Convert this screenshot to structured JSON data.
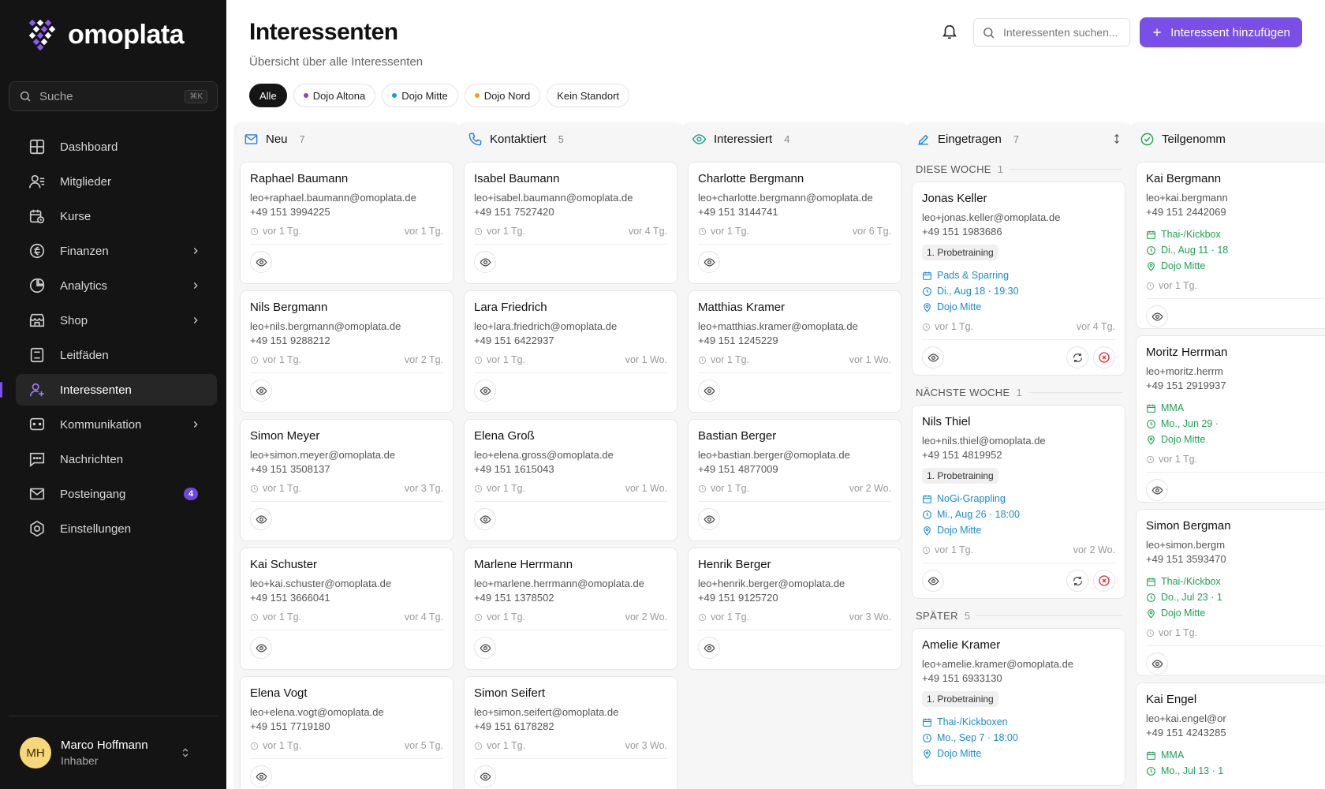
{
  "brand": {
    "name": "omoplata"
  },
  "sidebar": {
    "search_label": "Suche",
    "search_shortcut": "⌘K",
    "items": [
      {
        "label": "Dashboard",
        "icon": "dashboard-icon"
      },
      {
        "label": "Mitglieder",
        "icon": "members-icon"
      },
      {
        "label": "Kurse",
        "icon": "calendar-clock-icon"
      },
      {
        "label": "Finanzen",
        "icon": "finance-icon",
        "has_submenu": true
      },
      {
        "label": "Analytics",
        "icon": "pie-chart-icon",
        "has_submenu": true
      },
      {
        "label": "Shop",
        "icon": "store-icon",
        "has_submenu": true
      },
      {
        "label": "Leitfäden",
        "icon": "guide-icon"
      },
      {
        "label": "Interessenten",
        "icon": "user-plus-icon",
        "active": true
      },
      {
        "label": "Kommunikation",
        "icon": "communication-icon",
        "has_submenu": true
      },
      {
        "label": "Nachrichten",
        "icon": "message-icon"
      },
      {
        "label": "Posteingang",
        "icon": "mail-icon",
        "badge": "4"
      },
      {
        "label": "Einstellungen",
        "icon": "settings-icon"
      }
    ],
    "user": {
      "initials": "MH",
      "name": "Marco Hoffmann",
      "role": "Inhaber"
    }
  },
  "header": {
    "title": "Interessenten",
    "subtitle": "Übersicht über alle Interessenten",
    "search_placeholder": "Interessenten suchen...",
    "add_button": "Interessent hinzufügen"
  },
  "filters": [
    {
      "label": "Alle",
      "active": true
    },
    {
      "label": "Dojo Altona",
      "dot": "#8b3fd6"
    },
    {
      "label": "Dojo Mitte",
      "dot": "#1a9bd6"
    },
    {
      "label": "Dojo Nord",
      "dot": "#f0a020"
    },
    {
      "label": "Kein Standort"
    }
  ],
  "columns": {
    "neu": {
      "title": "Neu",
      "count": "7",
      "cards": [
        {
          "name": "Raphael Baumann",
          "email": "leo+raphael.baumann@omoplata.de",
          "phone": "+49 151 3994225",
          "created": "vor 1 Tg.",
          "updated": "vor 1 Tg."
        },
        {
          "name": "Nils Bergmann",
          "email": "leo+nils.bergmann@omoplata.de",
          "phone": "+49 151 9288212",
          "created": "vor 1 Tg.",
          "updated": "vor 2 Tg."
        },
        {
          "name": "Simon Meyer",
          "email": "leo+simon.meyer@omoplata.de",
          "phone": "+49 151 3508137",
          "created": "vor 1 Tg.",
          "updated": "vor 3 Tg."
        },
        {
          "name": "Kai Schuster",
          "email": "leo+kai.schuster@omoplata.de",
          "phone": "+49 151 3666041",
          "created": "vor 1 Tg.",
          "updated": "vor 4 Tg."
        },
        {
          "name": "Elena Vogt",
          "email": "leo+elena.vogt@omoplata.de",
          "phone": "+49 151 7719180",
          "created": "vor 1 Tg.",
          "updated": "vor 5 Tg."
        }
      ]
    },
    "kontaktiert": {
      "title": "Kontaktiert",
      "count": "5",
      "cards": [
        {
          "name": "Isabel Baumann",
          "email": "leo+isabel.baumann@omoplata.de",
          "phone": "+49 151 7527420",
          "created": "vor 1 Tg.",
          "updated": "vor 4 Tg."
        },
        {
          "name": "Lara Friedrich",
          "email": "leo+lara.friedrich@omoplata.de",
          "phone": "+49 151 6422937",
          "created": "vor 1 Tg.",
          "updated": "vor 1 Wo."
        },
        {
          "name": "Elena Groß",
          "email": "leo+elena.gross@omoplata.de",
          "phone": "+49 151 1615043",
          "created": "vor 1 Tg.",
          "updated": "vor 1 Wo."
        },
        {
          "name": "Marlene Herrmann",
          "email": "leo+marlene.herrmann@omoplata.de",
          "phone": "+49 151 1378502",
          "created": "vor 1 Tg.",
          "updated": "vor 2 Wo."
        },
        {
          "name": "Simon Seifert",
          "email": "leo+simon.seifert@omoplata.de",
          "phone": "+49 151 6178282",
          "created": "vor 1 Tg.",
          "updated": "vor 3 Wo."
        }
      ]
    },
    "interessiert": {
      "title": "Interessiert",
      "count": "4",
      "cards": [
        {
          "name": "Charlotte Bergmann",
          "email": "leo+charlotte.bergmann@omoplata.de",
          "phone": "+49 151 3144741",
          "created": "vor 1 Tg.",
          "updated": "vor 6 Tg."
        },
        {
          "name": "Matthias Kramer",
          "email": "leo+matthias.kramer@omoplata.de",
          "phone": "+49 151 1245229",
          "created": "vor 1 Tg.",
          "updated": "vor 1 Wo."
        },
        {
          "name": "Bastian Berger",
          "email": "leo+bastian.berger@omoplata.de",
          "phone": "+49 151 4877009",
          "created": "vor 1 Tg.",
          "updated": "vor 2 Wo."
        },
        {
          "name": "Henrik Berger",
          "email": "leo+henrik.berger@omoplata.de",
          "phone": "+49 151 9125720",
          "created": "vor 1 Tg.",
          "updated": "vor 3 Wo."
        }
      ]
    },
    "eingetragen": {
      "title": "Eingetragen",
      "count": "7",
      "sections": [
        {
          "label": "DIESE WOCHE",
          "count": "1",
          "card": {
            "name": "Jonas Keller",
            "email": "leo+jonas.keller@omoplata.de",
            "phone": "+49 151 1983686",
            "badge": "1. Probetraining",
            "course": "Pads & Sparring",
            "date": "Di., Aug 18 · 19:30",
            "location": "Dojo Mitte",
            "created": "vor 1 Tg.",
            "updated": "vor 4 Tg."
          }
        },
        {
          "label": "NÄCHSTE WOCHE",
          "count": "1",
          "card": {
            "name": "Nils Thiel",
            "email": "leo+nils.thiel@omoplata.de",
            "phone": "+49 151 4819952",
            "badge": "1. Probetraining",
            "course": "NoGi-Grappling",
            "date": "Mi., Aug 26 · 18:00",
            "location": "Dojo Mitte",
            "created": "vor 1 Tg.",
            "updated": "vor 2 Wo."
          }
        },
        {
          "label": "SPÄTER",
          "count": "5",
          "card": {
            "name": "Amelie Kramer",
            "email": "leo+amelie.kramer@omoplata.de",
            "phone": "+49 151 6933130",
            "badge": "1. Probetraining",
            "course": "Thai-/Kickboxen",
            "date": "Mo., Sep 7 · 18:00",
            "location": "Dojo Mitte"
          }
        }
      ]
    },
    "teilgenommen": {
      "title": "Teilgenomm",
      "cards": [
        {
          "name": "Kai Bergmann",
          "email": "leo+kai.bergmann",
          "phone": "+49 151 2442069",
          "course": "Thai-/Kickbox",
          "date": "Di., Aug 11 · 18",
          "location": "Dojo Mitte",
          "created": "vor 1 Tg."
        },
        {
          "name": "Moritz Herrman",
          "email": "leo+moritz.herrm",
          "phone": "+49 151 2919937",
          "course": "MMA",
          "date": "Mo., Jun 29 ·",
          "location": "Dojo Mitte",
          "created": "vor 1 Tg."
        },
        {
          "name": "Simon Bergman",
          "email": "leo+simon.bergm",
          "phone": "+49 151 3593470",
          "course": "Thai-/Kickbox",
          "date": "Do., Jul 23 · 1",
          "location": "Dojo Mitte",
          "created": "vor 1 Tg."
        },
        {
          "name": "Kai Engel",
          "email": "leo+kai.engel@or",
          "phone": "+49 151 4243285",
          "course": "MMA",
          "date": "Mo., Jul 13 · 1"
        }
      ]
    }
  },
  "colors": {
    "accent": "#7a4fe8",
    "sidebar_bg": "#141414",
    "link_blue": "#1a8ad6",
    "success_green": "#1ea154",
    "danger_red": "#e03131"
  }
}
